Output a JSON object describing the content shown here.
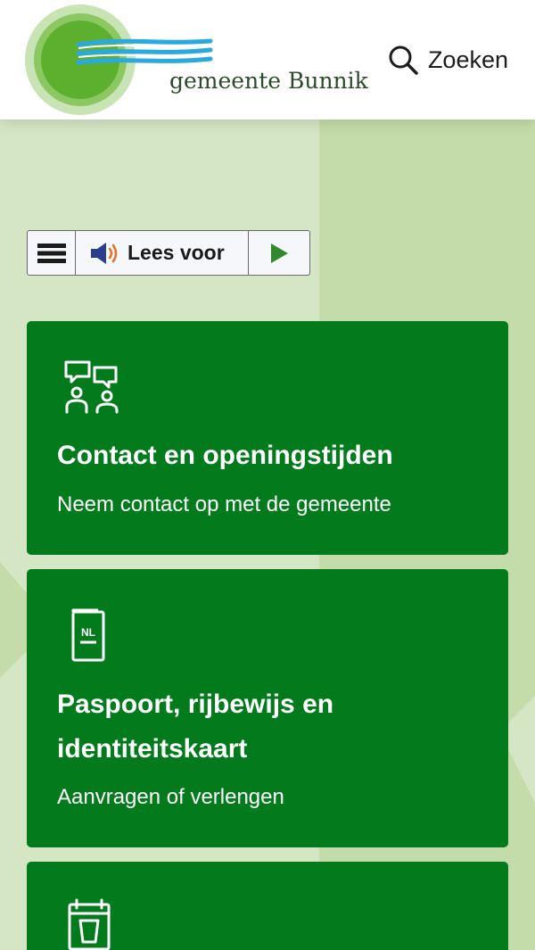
{
  "header": {
    "logo_text": "gemeente Bunnik",
    "search_label": "Zoeken"
  },
  "readbar": {
    "menu_icon": "hamburger-menu-icon",
    "speaker_icon": "speaker-icon",
    "label": "Lees voor",
    "play_icon": "play-icon"
  },
  "cards": [
    {
      "icon": "conversation-people-icon",
      "title": "Contact en openingstijden",
      "subtitle": "Neem contact op met de gemeente"
    },
    {
      "icon": "passport-nl-icon",
      "title": "Paspoort, rijbewijs en identiteitskaart",
      "subtitle": "Aanvragen of verlengen"
    },
    {
      "icon": "waste-bin-calendar-icon",
      "title": "",
      "subtitle": ""
    }
  ],
  "colors": {
    "card_green": "#037b1d",
    "background_light": "#d5e6c4",
    "background_mid": "#c2dba8",
    "logo_green": "#5db02e",
    "wave_blue": "#29a9e0"
  }
}
